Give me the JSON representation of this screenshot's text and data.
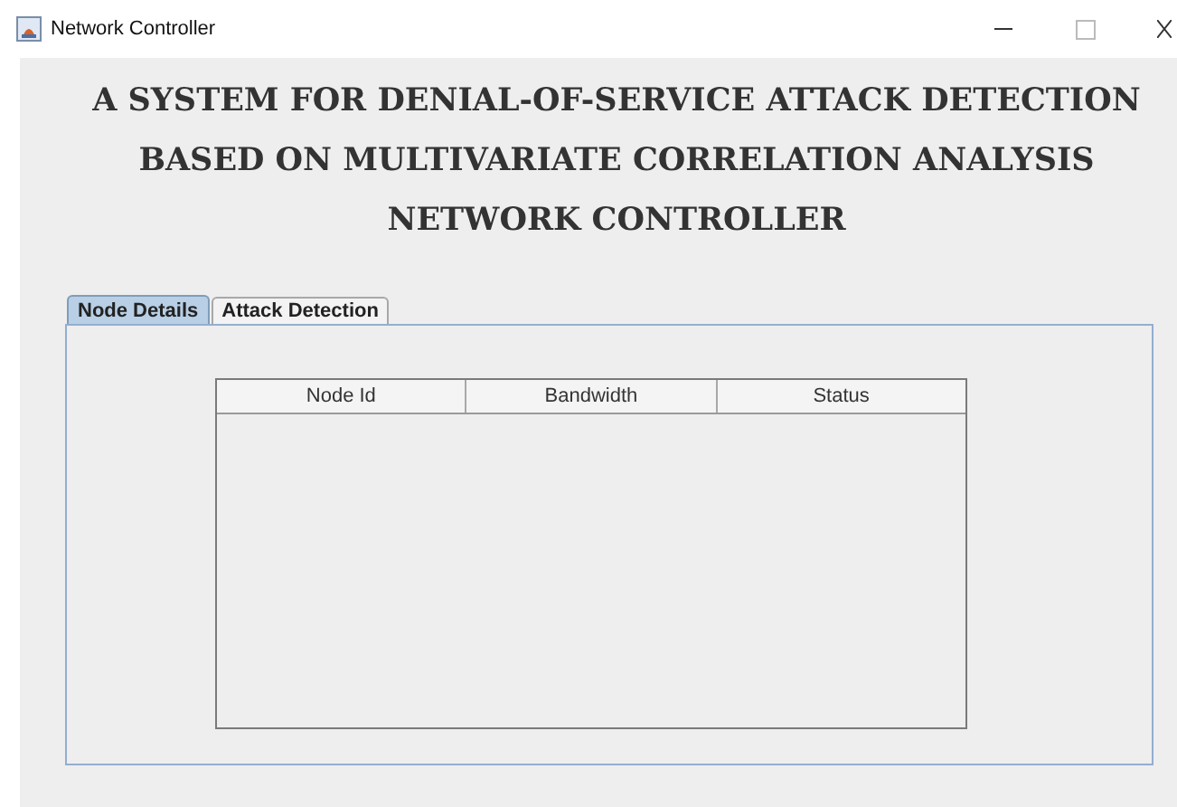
{
  "window": {
    "title": "Network Controller"
  },
  "heading": [
    "A SYSTEM FOR DENIAL-OF-SERVICE ATTACK DETECTION",
    "BASED ON MULTIVARIATE CORRELATION ANALYSIS",
    "NETWORK CONTROLLER"
  ],
  "tabs": [
    {
      "label": "Node Details",
      "selected": true
    },
    {
      "label": "Attack Detection",
      "selected": false
    }
  ],
  "table": {
    "columns": [
      "Node Id",
      "Bandwidth",
      "Status"
    ]
  }
}
